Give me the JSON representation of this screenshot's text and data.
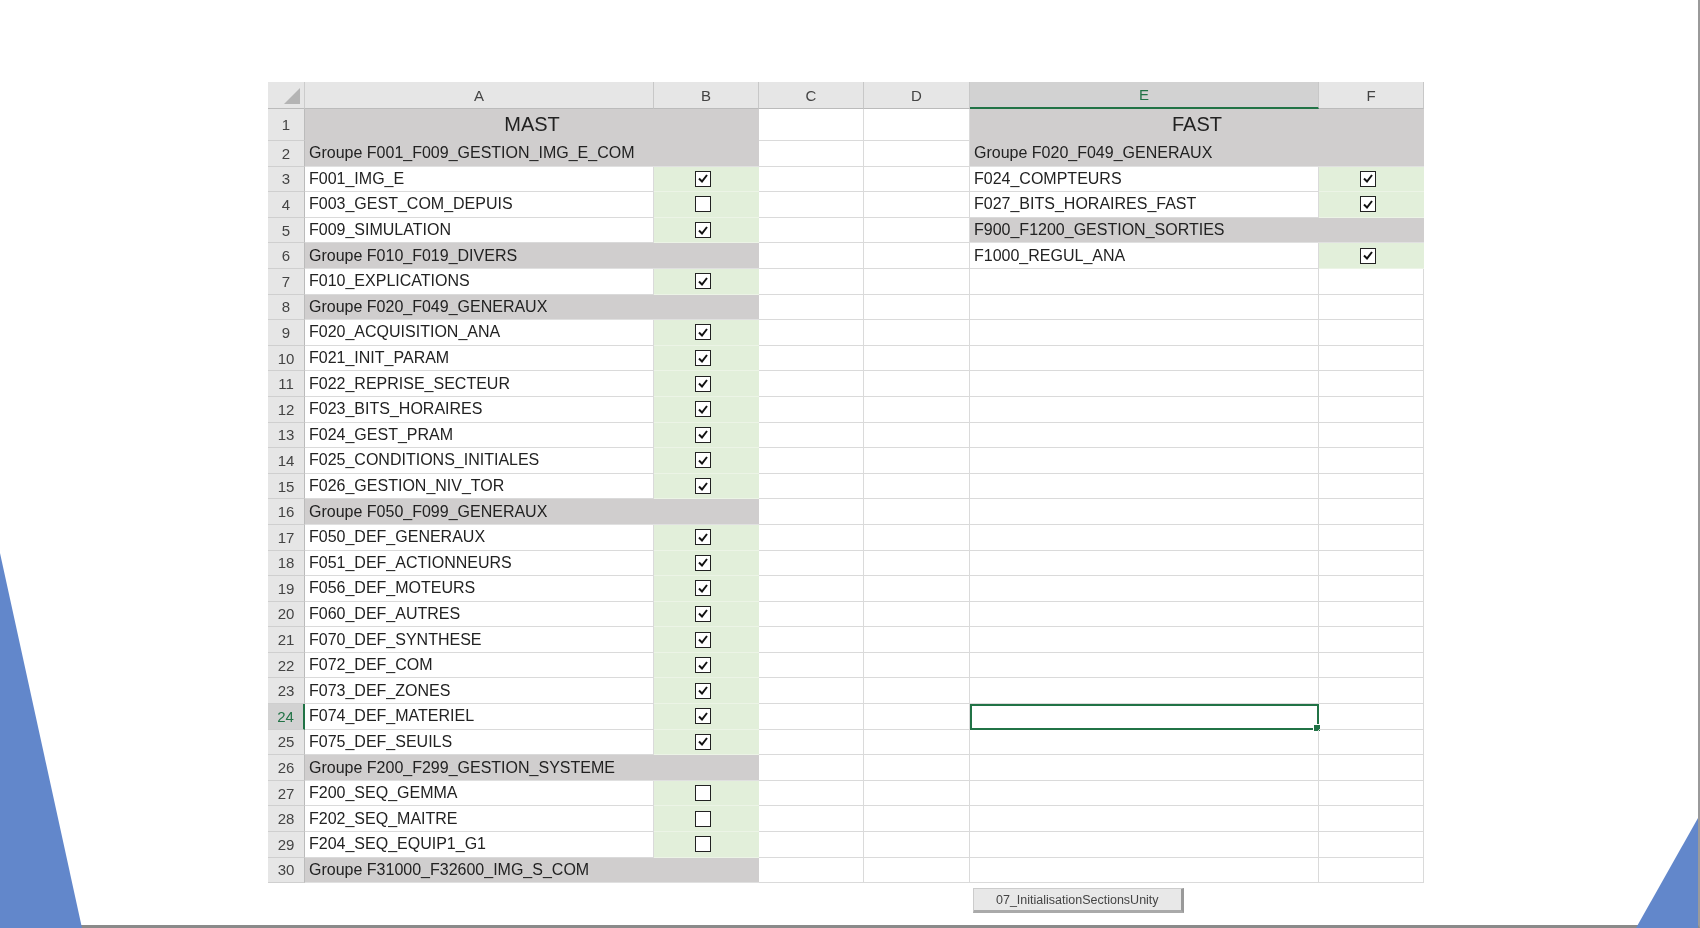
{
  "sheet": {
    "columns": [
      {
        "label": "A",
        "selected": false
      },
      {
        "label": "B",
        "selected": false
      },
      {
        "label": "C",
        "selected": false
      },
      {
        "label": "D",
        "selected": false
      },
      {
        "label": "E",
        "selected": true
      },
      {
        "label": "F",
        "selected": false
      }
    ],
    "rows": [
      {
        "number": "1",
        "selected": false,
        "mast": {
          "kind": "title",
          "text": "MAST"
        },
        "fast": {
          "kind": "title",
          "text": "FAST"
        }
      },
      {
        "number": "2",
        "selected": false,
        "mast": {
          "kind": "group",
          "text": "Groupe F001_F009_GESTION_IMG_E_COM"
        },
        "fast": {
          "kind": "group",
          "text": "Groupe F020_F049_GENERAUX"
        }
      },
      {
        "number": "3",
        "selected": false,
        "mast": {
          "kind": "item",
          "text": "F001_IMG_E",
          "checked": true
        },
        "fast": {
          "kind": "item",
          "text": "F024_COMPTEURS",
          "checked": true
        }
      },
      {
        "number": "4",
        "selected": false,
        "mast": {
          "kind": "item",
          "text": "F003_GEST_COM_DEPUIS",
          "checked": false
        },
        "fast": {
          "kind": "item",
          "text": "F027_BITS_HORAIRES_FAST",
          "checked": true
        }
      },
      {
        "number": "5",
        "selected": false,
        "mast": {
          "kind": "item",
          "text": "F009_SIMULATION",
          "checked": true
        },
        "fast": {
          "kind": "group",
          "text": "F900_F1200_GESTION_SORTIES"
        }
      },
      {
        "number": "6",
        "selected": false,
        "mast": {
          "kind": "group",
          "text": "Groupe F010_F019_DIVERS"
        },
        "fast": {
          "kind": "item",
          "text": "F1000_REGUL_ANA",
          "checked": true
        }
      },
      {
        "number": "7",
        "selected": false,
        "mast": {
          "kind": "item",
          "text": "F010_EXPLICATIONS",
          "checked": true
        }
      },
      {
        "number": "8",
        "selected": false,
        "mast": {
          "kind": "group",
          "text": "Groupe F020_F049_GENERAUX"
        }
      },
      {
        "number": "9",
        "selected": false,
        "mast": {
          "kind": "item",
          "text": "F020_ACQUISITION_ANA",
          "checked": true
        }
      },
      {
        "number": "10",
        "selected": false,
        "mast": {
          "kind": "item",
          "text": "F021_INIT_PARAM",
          "checked": true
        }
      },
      {
        "number": "11",
        "selected": false,
        "mast": {
          "kind": "item",
          "text": "F022_REPRISE_SECTEUR",
          "checked": true
        }
      },
      {
        "number": "12",
        "selected": false,
        "mast": {
          "kind": "item",
          "text": "F023_BITS_HORAIRES",
          "checked": true
        }
      },
      {
        "number": "13",
        "selected": false,
        "mast": {
          "kind": "item",
          "text": "F024_GEST_PRAM",
          "checked": true
        }
      },
      {
        "number": "14",
        "selected": false,
        "mast": {
          "kind": "item",
          "text": "F025_CONDITIONS_INITIALES",
          "checked": true
        }
      },
      {
        "number": "15",
        "selected": false,
        "mast": {
          "kind": "item",
          "text": "F026_GESTION_NIV_TOR",
          "checked": true
        }
      },
      {
        "number": "16",
        "selected": false,
        "mast": {
          "kind": "group",
          "text": "Groupe F050_F099_GENERAUX"
        }
      },
      {
        "number": "17",
        "selected": false,
        "mast": {
          "kind": "item",
          "text": "F050_DEF_GENERAUX",
          "checked": true
        }
      },
      {
        "number": "18",
        "selected": false,
        "mast": {
          "kind": "item",
          "text": "F051_DEF_ACTIONNEURS",
          "checked": true
        }
      },
      {
        "number": "19",
        "selected": false,
        "mast": {
          "kind": "item",
          "text": "F056_DEF_MOTEURS",
          "checked": true
        }
      },
      {
        "number": "20",
        "selected": false,
        "mast": {
          "kind": "item",
          "text": "F060_DEF_AUTRES",
          "checked": true
        }
      },
      {
        "number": "21",
        "selected": false,
        "mast": {
          "kind": "item",
          "text": "F070_DEF_SYNTHESE",
          "checked": true
        }
      },
      {
        "number": "22",
        "selected": false,
        "mast": {
          "kind": "item",
          "text": "F072_DEF_COM",
          "checked": true
        }
      },
      {
        "number": "23",
        "selected": false,
        "mast": {
          "kind": "item",
          "text": "F073_DEF_ZONES",
          "checked": true
        }
      },
      {
        "number": "24",
        "selected": true,
        "mast": {
          "kind": "item",
          "text": "F074_DEF_MATERIEL",
          "checked": true
        }
      },
      {
        "number": "25",
        "selected": false,
        "mast": {
          "kind": "item",
          "text": "F075_DEF_SEUILS",
          "checked": true
        }
      },
      {
        "number": "26",
        "selected": false,
        "mast": {
          "kind": "group",
          "text": "Groupe F200_F299_GESTION_SYSTEME"
        }
      },
      {
        "number": "27",
        "selected": false,
        "mast": {
          "kind": "item",
          "text": "F200_SEQ_GEMMA",
          "checked": false
        }
      },
      {
        "number": "28",
        "selected": false,
        "mast": {
          "kind": "item",
          "text": "F202_SEQ_MAITRE",
          "checked": false
        }
      },
      {
        "number": "29",
        "selected": false,
        "mast": {
          "kind": "item",
          "text": "F204_SEQ_EQUIP1_G1",
          "checked": false
        }
      },
      {
        "number": "30",
        "selected": false,
        "mast": {
          "kind": "group",
          "text": "Groupe F31000_F32600_IMG_S_COM"
        }
      }
    ]
  },
  "sheet_tabs": [
    {
      "label": "07_InitialisationSectionsUnity"
    }
  ]
}
